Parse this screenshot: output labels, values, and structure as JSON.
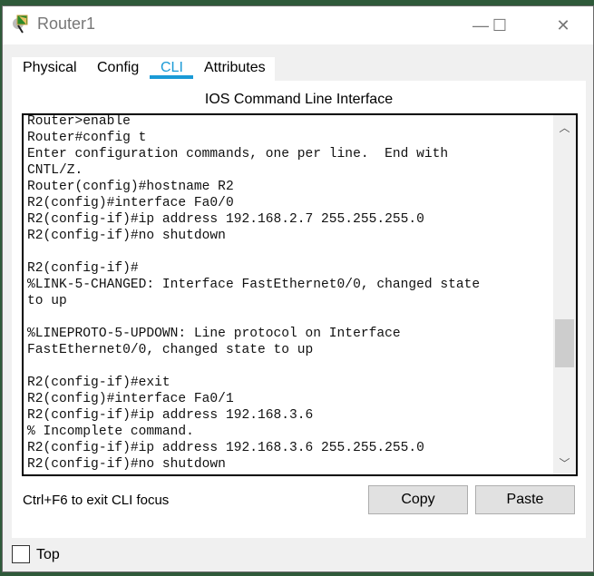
{
  "window": {
    "title": "Router1",
    "minimize": "—",
    "maximize": "☐",
    "close": "✕"
  },
  "tabs": [
    {
      "label": "Physical"
    },
    {
      "label": "Config"
    },
    {
      "label": "CLI",
      "active": true
    },
    {
      "label": "Attributes"
    }
  ],
  "accent": "#1a9ad6",
  "cli": {
    "header": "IOS Command Line Interface",
    "lines": [
      "Router>enable",
      "Router#config t",
      "Enter configuration commands, one per line.  End with",
      "CNTL/Z.",
      "Router(config)#hostname R2",
      "R2(config)#interface Fa0/0",
      "R2(config-if)#ip address 192.168.2.7 255.255.255.0",
      "R2(config-if)#no shutdown",
      "",
      "R2(config-if)#",
      "%LINK-5-CHANGED: Interface FastEthernet0/0, changed state",
      "to up",
      "",
      "%LINEPROTO-5-UPDOWN: Line protocol on Interface",
      "FastEthernet0/0, changed state to up",
      "",
      "R2(config-if)#exit",
      "R2(config)#interface Fa0/1",
      "R2(config-if)#ip address 192.168.3.6",
      "% Incomplete command.",
      "R2(config-if)#ip address 192.168.3.6 255.255.255.0",
      "R2(config-if)#no shutdown"
    ],
    "hint": "Ctrl+F6 to exit CLI focus",
    "copy": "Copy",
    "paste": "Paste"
  },
  "top_checkbox": {
    "label": "Top",
    "checked": false
  }
}
